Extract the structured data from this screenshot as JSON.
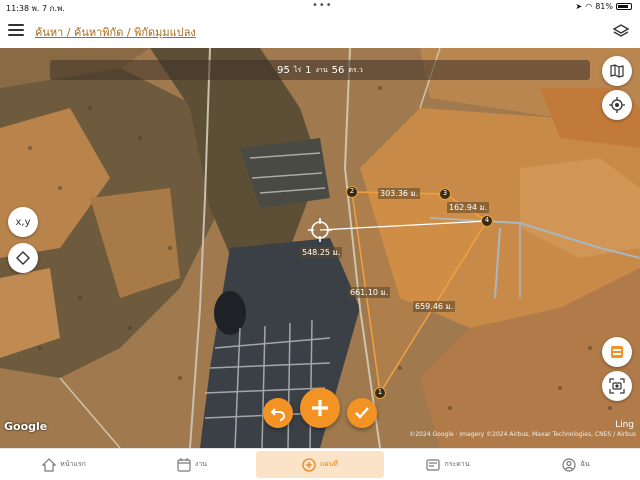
{
  "status": {
    "time": "11:38",
    "date": "พ. 7 ก.พ.",
    "battery": "81%"
  },
  "header": {
    "breadcrumb": "ค้นหา / ค้นหาพิกัด / พิกัดมุมแปลง"
  },
  "area": {
    "rai": "95",
    "rai_unit": "ไร่",
    "ngan": "1",
    "ngan_unit": "งาน",
    "wa": "56",
    "wa_unit": "ตร.ว"
  },
  "map_controls": {
    "xy_label": "x,y"
  },
  "distances": {
    "d1": "303.36 ม.",
    "d2": "162.94 ม.",
    "d3": "548.25 ม.",
    "d4": "661.10 ม.",
    "d5": "659.46 ม."
  },
  "vertices": {
    "v1": "1",
    "v2": "2",
    "v3": "3",
    "v4": "4"
  },
  "map_footer": {
    "google": "Google",
    "ling": "Ling",
    "copyright": "©2024 Google · Imagery ©2024 Airbus, Maxar Technologies, CNES / Airbus"
  },
  "nav": {
    "home": "หน้าแรก",
    "jobs": "งาน",
    "map": "แผนที่",
    "board": "กระดาน",
    "me": "ฉัน"
  },
  "colors": {
    "accent": "#f39324",
    "brand": "#a86a18"
  }
}
